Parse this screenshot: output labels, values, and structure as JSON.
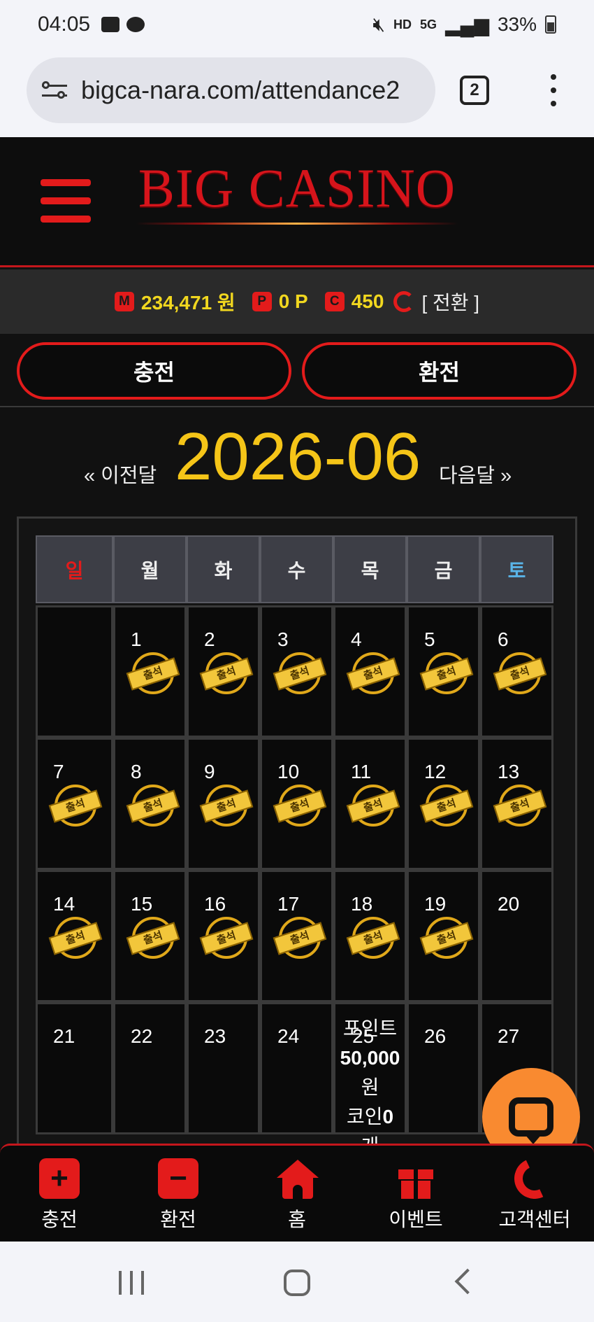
{
  "status_bar": {
    "time": "04:05",
    "battery": "33%",
    "network": "5G",
    "hd": "HD"
  },
  "browser": {
    "url": "bigca-nara.com/attendance2",
    "tab_count": "2"
  },
  "header": {
    "logo": "BIG CASINO"
  },
  "balance": {
    "money_badge": "M",
    "money": "234,471 원",
    "point_badge": "P",
    "points": "0 P",
    "coin_badge": "C",
    "coins": "450",
    "switch_label": "[ 전환 ]"
  },
  "actions": {
    "charge": "충전",
    "exchange": "환전"
  },
  "month_nav": {
    "prev": "« 이전달",
    "current": "2026-06",
    "next": "다음달 »"
  },
  "calendar": {
    "weekdays": [
      "일",
      "월",
      "화",
      "수",
      "목",
      "금",
      "토"
    ],
    "stamp_label": "출석",
    "weeks": [
      [
        {
          "day": "",
          "stamped": false
        },
        {
          "day": "1",
          "stamped": true
        },
        {
          "day": "2",
          "stamped": true
        },
        {
          "day": "3",
          "stamped": true
        },
        {
          "day": "4",
          "stamped": true
        },
        {
          "day": "5",
          "stamped": true
        },
        {
          "day": "6",
          "stamped": true
        }
      ],
      [
        {
          "day": "7",
          "stamped": true
        },
        {
          "day": "8",
          "stamped": true
        },
        {
          "day": "9",
          "stamped": true
        },
        {
          "day": "10",
          "stamped": true
        },
        {
          "day": "11",
          "stamped": true
        },
        {
          "day": "12",
          "stamped": true
        },
        {
          "day": "13",
          "stamped": true
        }
      ],
      [
        {
          "day": "14",
          "stamped": true
        },
        {
          "day": "15",
          "stamped": true
        },
        {
          "day": "16",
          "stamped": true
        },
        {
          "day": "17",
          "stamped": true
        },
        {
          "day": "18",
          "stamped": true
        },
        {
          "day": "19",
          "stamped": true
        },
        {
          "day": "20",
          "stamped": false
        }
      ],
      [
        {
          "day": "21",
          "stamped": false
        },
        {
          "day": "22",
          "stamped": false
        },
        {
          "day": "23",
          "stamped": false
        },
        {
          "day": "24",
          "stamped": false
        },
        {
          "day": "25",
          "stamped": false
        },
        {
          "day": "26",
          "stamped": false
        },
        {
          "day": "27",
          "stamped": false
        }
      ]
    ],
    "reward": {
      "point_label": "포인트",
      "point_amount": "50,000",
      "point_unit": "원",
      "coin_label": "코인",
      "coin_amount": "0",
      "coin_unit": "개"
    }
  },
  "bottom_nav": [
    {
      "label": "충전",
      "icon": "plus-icon"
    },
    {
      "label": "환전",
      "icon": "minus-icon"
    },
    {
      "label": "홈",
      "icon": "home-icon"
    },
    {
      "label": "이벤트",
      "icon": "gift-icon"
    },
    {
      "label": "고객센터",
      "icon": "phone-icon"
    }
  ],
  "colors": {
    "accent": "#e31b1b",
    "gold": "#f5c518",
    "chat": "#f98a30"
  }
}
